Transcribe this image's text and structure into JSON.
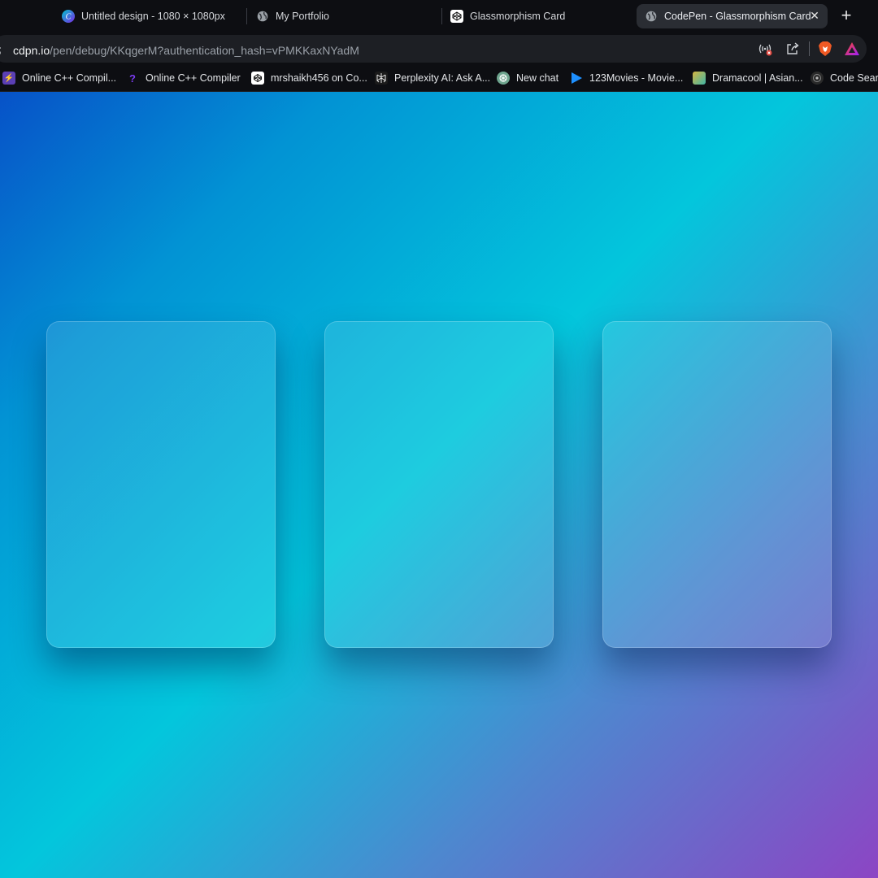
{
  "browser": {
    "tabs": [
      {
        "title": "Untitled design - 1080 × 1080px",
        "icon": "canva-icon",
        "active": false
      },
      {
        "title": "My Portfolio",
        "icon": "globe-icon",
        "active": false
      },
      {
        "title": "Glassmorphism Card",
        "icon": "codepen-icon",
        "active": false
      },
      {
        "title": "CodePen - Glassmorphism Card",
        "icon": "globe-icon",
        "active": true
      }
    ],
    "new_tab_label": "+",
    "close_tab_label": "✕",
    "address": {
      "host": "cdpn.io",
      "path": "/pen/debug/KKqgerM?authentication_hash=vPMKKaxNYadM"
    },
    "toolbar_icons": [
      "media-blocked-icon",
      "share-icon",
      "brave-shields-icon",
      "brave-rewards-icon"
    ]
  },
  "bookmarks": [
    {
      "label": "Online C++ Compil...",
      "icon": "bolt-icon",
      "color": "#5b3fb5"
    },
    {
      "label": "Online C++ Compiler",
      "icon": "question-icon",
      "color": "#6b2bd9"
    },
    {
      "label": "mrshaikh456 on Co...",
      "icon": "codepen-icon",
      "color": "#ffffff"
    },
    {
      "label": "Perplexity AI: Ask A...",
      "icon": "perplexity-icon",
      "color": "#ffffff"
    },
    {
      "label": "New chat",
      "icon": "openai-icon",
      "color": "#6fa58f"
    },
    {
      "label": "123Movies - Movie...",
      "icon": "play-icon",
      "color": "#1e90ff"
    },
    {
      "label": "Dramacool | Asian...",
      "icon": "dramacool-icon",
      "color": "#d7b640"
    },
    {
      "label": "Code Search",
      "icon": "code-search-icon",
      "color": "#333333"
    }
  ],
  "page": {
    "background_colors": [
      "#0752c8",
      "#03c6dc",
      "#8c45c4"
    ],
    "cards": [
      {
        "name": "glass-card-1"
      },
      {
        "name": "glass-card-2"
      },
      {
        "name": "glass-card-3"
      }
    ]
  }
}
